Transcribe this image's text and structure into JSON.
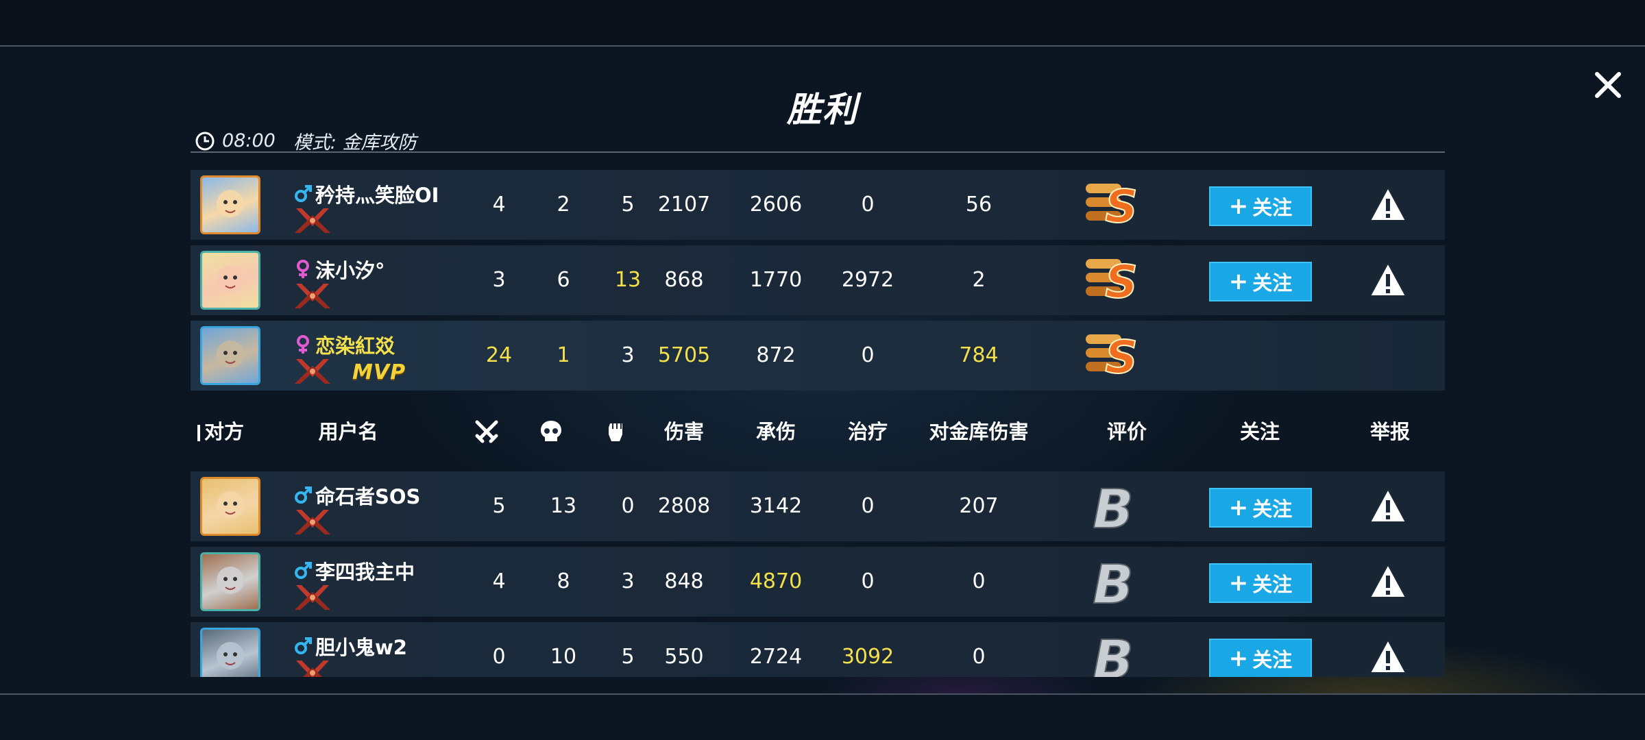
{
  "title": "胜利",
  "match": {
    "time": "08:00",
    "mode": "模式: 金库攻防"
  },
  "headers": {
    "opponent": "对方",
    "username": "用户名",
    "damage": "伤害",
    "taken": "承伤",
    "heal": "治疗",
    "vault": "对金库伤害",
    "rating": "评价",
    "follow": "关注",
    "report": "举报",
    "kills_icon": "crossed-swords-icon",
    "deaths_icon": "skull-icon",
    "assists_icon": "fist-icon"
  },
  "follow_label": "关注",
  "follow_plus": "+",
  "mvp_label": "MVP",
  "colors": {
    "highlight": "#f4e04a",
    "follow": "#1aa7e6",
    "rank": "#c0392b"
  },
  "team": [
    {
      "name": "矜持灬笑脸OI",
      "gender": "male",
      "kills": "4",
      "deaths": "2",
      "assists": "5",
      "damage": "2107",
      "taken": "2606",
      "heal": "0",
      "vault": "56",
      "grade": "S",
      "mvp": false,
      "self": false
    },
    {
      "name": "沫小汐°",
      "gender": "female",
      "kills": "3",
      "deaths": "6",
      "assists": "13",
      "damage": "868",
      "taken": "1770",
      "heal": "2972",
      "vault": "2",
      "grade": "S",
      "mvp": false,
      "self": false
    },
    {
      "name": "恋染紅㸚",
      "gender": "female",
      "kills": "24",
      "deaths": "1",
      "assists": "3",
      "damage": "5705",
      "taken": "872",
      "heal": "0",
      "vault": "784",
      "grade": "S",
      "mvp": true,
      "self": true
    }
  ],
  "opponents": [
    {
      "name": "命石者SOS",
      "gender": "male",
      "kills": "5",
      "deaths": "13",
      "assists": "0",
      "damage": "2808",
      "taken": "3142",
      "heal": "0",
      "vault": "207",
      "grade": "B"
    },
    {
      "name": "李四我主中",
      "gender": "male",
      "kills": "4",
      "deaths": "8",
      "assists": "3",
      "damage": "848",
      "taken": "4870",
      "heal": "0",
      "vault": "0",
      "grade": "B"
    },
    {
      "name": "胆小鬼w2",
      "gender": "male",
      "kills": "0",
      "deaths": "10",
      "assists": "5",
      "damage": "550",
      "taken": "2724",
      "heal": "3092",
      "vault": "0",
      "grade": "B"
    }
  ]
}
